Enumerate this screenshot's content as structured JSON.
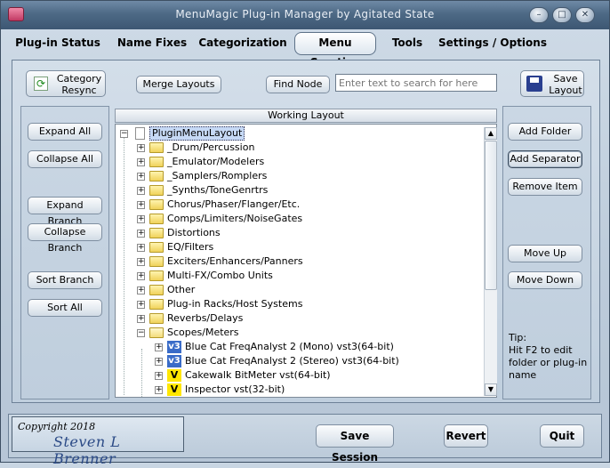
{
  "window": {
    "title": "MenuMagic Plug-in Manager by Agitated State"
  },
  "tabs": [
    {
      "label": "Plug-in Status"
    },
    {
      "label": "Name Fixes"
    },
    {
      "label": "Categorization"
    },
    {
      "label": "Menu Creation"
    },
    {
      "label": "Tools"
    },
    {
      "label": "Settings / Options"
    }
  ],
  "active_tab": "Menu Creation",
  "toolbar": {
    "category_resync": "Category\nResync",
    "category_resync_l1": "Category",
    "category_resync_l2": "Resync",
    "merge_layouts": "Merge Layouts",
    "find_node": "Find Node",
    "search_placeholder": "Enter text to search for here",
    "save_layout_l1": "Save",
    "save_layout_l2": "Layout"
  },
  "left_buttons": {
    "expand_all": "Expand All",
    "collapse_all": "Collapse All",
    "expand_branch": "Expand Branch",
    "collapse_branch": "Collapse Branch",
    "sort_branch": "Sort Branch",
    "sort_all": "Sort All"
  },
  "right_buttons": {
    "add_folder": "Add Folder",
    "add_separator": "Add Separator",
    "remove_item": "Remove Item",
    "move_up": "Move Up",
    "move_down": "Move Down"
  },
  "tip": "Tip:\nHit F2 to edit folder or plug-in name",
  "tip_lines": [
    "Tip:",
    "Hit F2 to edit",
    "folder or plug-in",
    "name"
  ],
  "tree": {
    "header": "Working Layout",
    "root": "PluginMenuLayout",
    "folders": [
      "_Drum/Percussion",
      "_Emulator/Modelers",
      "_Samplers/Romplers",
      "_Synths/ToneGenrtrs",
      "Chorus/Phaser/Flanger/Etc.",
      "Comps/Limiters/NoiseGates",
      "Distortions",
      "EQ/Filters",
      "Exciters/Enhancers/Panners",
      "Multi-FX/Combo Units",
      "Other",
      "Plug-in Racks/Host Systems",
      "Reverbs/Delays",
      "Scopes/Meters"
    ],
    "scopes_children": [
      {
        "badge": "v3",
        "label": "Blue Cat FreqAnalyst 2 (Mono) vst3(64-bit)"
      },
      {
        "badge": "v3",
        "label": "Blue Cat FreqAnalyst 2 (Stereo) vst3(64-bit)"
      },
      {
        "badge": "V",
        "label": "Cakewalk BitMeter vst(64-bit)"
      },
      {
        "badge": "V",
        "label": "Inspector vst(32-bit)"
      }
    ]
  },
  "footer": {
    "copyright": "Copyright 2018",
    "author": "Steven L Brenner",
    "save_session": "Save Session",
    "revert": "Revert",
    "quit": "Quit"
  }
}
